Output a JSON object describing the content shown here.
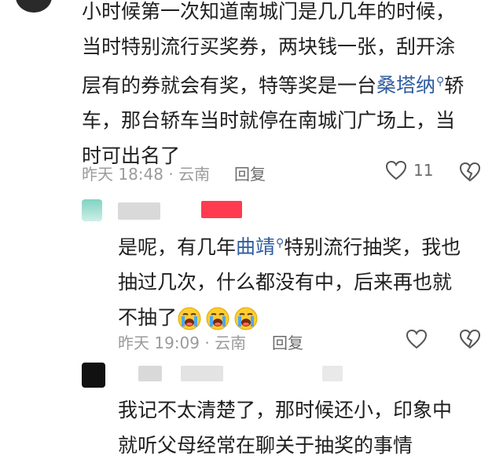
{
  "comments": [
    {
      "lines": [
        [
          "小时候第一次知道南城门是几几年的时候，"
        ],
        [
          "当时特别流行买奖券，两块钱一张，刮开涂"
        ],
        [
          "层有的券就会有奖，特等奖是一台",
          {
            "link": "桑塔纳"
          },
          "轿"
        ],
        [
          "车，那台轿车当时就停在南城门广场上，当"
        ],
        [
          "时可出名了"
        ]
      ],
      "time": "昨天 18:48 · 云南",
      "reply": "回复",
      "likes": "11"
    },
    {
      "lines": [
        [
          "是呢，有几年",
          {
            "link": "曲靖"
          },
          "特别流行抽奖，我也"
        ],
        [
          "抽过几次，什么都没有中，后来再也就"
        ],
        [
          "不抽了"
        ]
      ],
      "emoji_count": 3,
      "time": "昨天 19:09 · 云南",
      "reply": "回复"
    },
    {
      "lines": [
        [
          "我记不太清楚了，那时候还小，印象中"
        ],
        [
          "就听父母经常在聊关于抽奖的事情"
        ]
      ]
    }
  ],
  "colors": {
    "link": "#2f5d9e",
    "meta": "#9b9b9b",
    "text": "#1f1f1f"
  },
  "icons": [
    "search-icon",
    "heart-icon",
    "broken-heart-icon",
    "crying-emoji-icon"
  ]
}
